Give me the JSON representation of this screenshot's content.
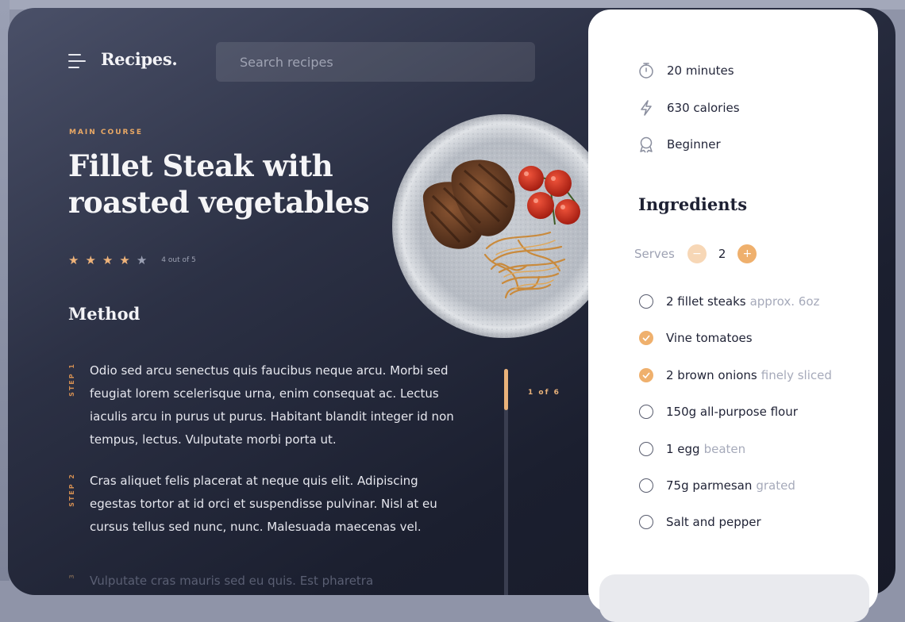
{
  "header": {
    "brand": "Recipes.",
    "search_placeholder": "Search recipes"
  },
  "recipe": {
    "category": "MAIN COURSE",
    "title": "Fillet Steak with roasted vegetables",
    "rating": {
      "value": 4,
      "max": 5,
      "label": "4 out of 5"
    }
  },
  "method": {
    "title": "Method",
    "pager": "1 of 6",
    "steps": [
      {
        "label": "STEP 1",
        "text": "Odio sed arcu senectus quis faucibus neque arcu. Morbi sed feugiat lorem scelerisque urna, enim consequat ac. Lectus iaculis arcu in purus ut purus. Habitant blandit integer id non tempus, lectus. Vulputate morbi porta ut."
      },
      {
        "label": "STEP 2",
        "text": "Cras aliquet felis placerat at neque quis elit. Adipiscing egestas tortor at id orci et suspendisse pulvinar. Nisl at eu cursus tellus sed nunc, nunc. Malesuada maecenas vel."
      },
      {
        "label": "3",
        "text": "Vulputate cras mauris sed eu quis. Est pharetra"
      }
    ]
  },
  "details": {
    "time": "20 minutes",
    "calories": "630 calories",
    "difficulty": "Beginner"
  },
  "ingredients": {
    "title": "Ingredients",
    "serves_label": "Serves",
    "serves_value": "2",
    "minus_label": "−",
    "plus_label": "+",
    "items": [
      {
        "name": "2 fillet steaks",
        "note": "approx. 6oz",
        "checked": false
      },
      {
        "name": "Vine tomatoes",
        "note": "",
        "checked": true
      },
      {
        "name": "2 brown onions",
        "note": "finely sliced",
        "checked": true
      },
      {
        "name": "150g all-purpose flour",
        "note": "",
        "checked": false
      },
      {
        "name": "1 egg",
        "note": "beaten",
        "checked": false
      },
      {
        "name": "75g parmesan",
        "note": "grated",
        "checked": false
      },
      {
        "name": "Salt and pepper",
        "note": "",
        "checked": false
      }
    ]
  },
  "colors": {
    "accent": "#efb06d",
    "dark": "#1e2133",
    "muted": "#a6aaba"
  },
  "icons": [
    "menu-icon",
    "timer-icon",
    "lightning-icon",
    "award-icon",
    "star-icon",
    "check-icon"
  ]
}
